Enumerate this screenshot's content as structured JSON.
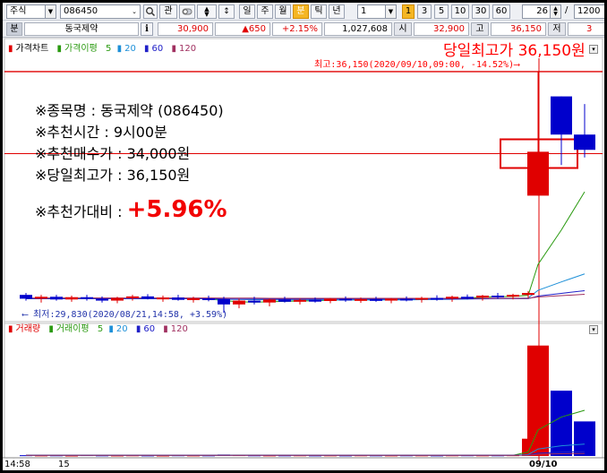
{
  "toolbar": {
    "market": "주식",
    "code": "086450",
    "gwan": "관",
    "periods": [
      "일",
      "주",
      "월",
      "분",
      "틱",
      "년"
    ],
    "period_active": "분",
    "interval_value": "1",
    "minute_buttons": [
      "1",
      "3",
      "5",
      "10",
      "30",
      "60"
    ],
    "minute_active": "1",
    "count_value": "26",
    "slash": "/",
    "total_value": "1200"
  },
  "quote": {
    "bun": "분",
    "name": "동국제약",
    "info_icon": "i",
    "price": "30,900",
    "change": "▲650",
    "change_pct": "+2.15%",
    "volume": "1,027,608",
    "open_label": "시",
    "open": "32,900",
    "high_label": "고",
    "high": "36,150",
    "low_label": "저",
    "low": "3"
  },
  "price_panel": {
    "legend": {
      "chart": "가격차트",
      "ma": "가격이평",
      "ma5": "5",
      "ma20": "20",
      "ma60": "60",
      "ma120": "120"
    },
    "high_annotation_big": "당일최고가 36,150원",
    "high_annotation_small": "최고:36,150(2020/09/10,09:00, -14.52%)⟶",
    "low_annotation": "⟵ 최저:29,830(2020/08/21,14:58, +3.59%)"
  },
  "info_box": {
    "line1": "※종목명 : 동국제약 (086450)",
    "line2": "※추천시간 : 9시00분",
    "line3": "※추천매수가 : 34,000원",
    "line4": "※당일최고가 : 36,150원",
    "line5_label": "※추천가대비 : ",
    "line5_value": "+5.96%"
  },
  "volume_panel": {
    "legend": {
      "vol": "거래량",
      "ma": "거래이평",
      "ma5": "5",
      "ma20": "20",
      "ma60": "60",
      "ma120": "120"
    }
  },
  "xaxis": {
    "labels": [
      "14:58",
      "15",
      "09/10"
    ]
  },
  "colors": {
    "up": "#e00000",
    "down": "#0000cc",
    "ma5": "#2a9a10",
    "ma20": "#1e90d8",
    "ma60": "#2020c8",
    "ma120": "#a03060",
    "accent": "#f5b623"
  },
  "chart_data": [
    {
      "type": "candlestick",
      "title": "가격차트",
      "series": [
        {
          "name": "가격차트",
          "values": [
            {
              "o": 30300,
              "h": 30350,
              "l": 30150,
              "c": 30200
            },
            {
              "o": 30200,
              "h": 30300,
              "l": 30100,
              "c": 30250
            },
            {
              "o": 30250,
              "h": 30300,
              "l": 30150,
              "c": 30180
            },
            {
              "o": 30180,
              "h": 30280,
              "l": 30120,
              "c": 30240
            },
            {
              "o": 30240,
              "h": 30300,
              "l": 30150,
              "c": 30200
            },
            {
              "o": 30200,
              "h": 30260,
              "l": 30100,
              "c": 30150
            },
            {
              "o": 30150,
              "h": 30250,
              "l": 30080,
              "c": 30220
            },
            {
              "o": 30220,
              "h": 30300,
              "l": 30150,
              "c": 30260
            },
            {
              "o": 30260,
              "h": 30320,
              "l": 30180,
              "c": 30200
            },
            {
              "o": 30200,
              "h": 30280,
              "l": 30120,
              "c": 30230
            },
            {
              "o": 30230,
              "h": 30300,
              "l": 30150,
              "c": 30170
            },
            {
              "o": 30170,
              "h": 30250,
              "l": 30100,
              "c": 30210
            },
            {
              "o": 30210,
              "h": 30280,
              "l": 30130,
              "c": 30190
            },
            {
              "o": 30190,
              "h": 30250,
              "l": 29830,
              "c": 30050
            },
            {
              "o": 30050,
              "h": 30200,
              "l": 29950,
              "c": 30150
            },
            {
              "o": 30150,
              "h": 30250,
              "l": 30050,
              "c": 30100
            },
            {
              "o": 30100,
              "h": 30200,
              "l": 30000,
              "c": 30180
            },
            {
              "o": 30180,
              "h": 30250,
              "l": 30100,
              "c": 30120
            },
            {
              "o": 30120,
              "h": 30200,
              "l": 30050,
              "c": 30170
            },
            {
              "o": 30170,
              "h": 30230,
              "l": 30100,
              "c": 30140
            },
            {
              "o": 30140,
              "h": 30220,
              "l": 30080,
              "c": 30200
            },
            {
              "o": 30200,
              "h": 30260,
              "l": 30120,
              "c": 30160
            },
            {
              "o": 30160,
              "h": 30230,
              "l": 30090,
              "c": 30190
            },
            {
              "o": 30190,
              "h": 30250,
              "l": 30120,
              "c": 30150
            },
            {
              "o": 30150,
              "h": 30220,
              "l": 30080,
              "c": 30200
            },
            {
              "o": 30200,
              "h": 30260,
              "l": 30130,
              "c": 30180
            },
            {
              "o": 30180,
              "h": 30250,
              "l": 30100,
              "c": 30220
            },
            {
              "o": 30220,
              "h": 30290,
              "l": 30150,
              "c": 30200
            },
            {
              "o": 30200,
              "h": 30280,
              "l": 30120,
              "c": 30250
            },
            {
              "o": 30250,
              "h": 30310,
              "l": 30180,
              "c": 30230
            },
            {
              "o": 30230,
              "h": 30300,
              "l": 30150,
              "c": 30280
            },
            {
              "o": 30280,
              "h": 30350,
              "l": 30200,
              "c": 30260
            },
            {
              "o": 30260,
              "h": 30330,
              "l": 30180,
              "c": 30300
            },
            {
              "o": 30300,
              "h": 30400,
              "l": 30220,
              "c": 30350
            },
            {
              "o": 32900,
              "h": 36150,
              "l": 32900,
              "c": 34050
            },
            {
              "o": 35500,
              "h": 35500,
              "l": 33700,
              "c": 34500
            },
            {
              "o": 34500,
              "h": 35300,
              "l": 33900,
              "c": 34100
            }
          ]
        },
        {
          "name": "5",
          "values": [
            30200,
            30210,
            30220,
            30215,
            30220,
            30210,
            30200,
            30215,
            30220,
            30210,
            30205,
            30200,
            30195,
            30150,
            30120,
            30110,
            30120,
            30130,
            30140,
            30145,
            30160,
            30170,
            30170,
            30175,
            30180,
            30185,
            30190,
            30200,
            30210,
            30220,
            30240,
            30250,
            30260,
            30290,
            31100,
            32000,
            33000
          ]
        },
        {
          "name": "20",
          "values": [
            30200,
            30200,
            30200,
            30200,
            30200,
            30200,
            30200,
            30200,
            30200,
            30200,
            30200,
            30200,
            30195,
            30185,
            30180,
            30175,
            30170,
            30165,
            30165,
            30165,
            30165,
            30165,
            30165,
            30165,
            30165,
            30170,
            30175,
            30180,
            30185,
            30190,
            30200,
            30205,
            30210,
            30220,
            30420,
            30640,
            30850
          ]
        },
        {
          "name": "60",
          "values": [
            30200,
            30200,
            30200,
            30200,
            30200,
            30200,
            30200,
            30200,
            30200,
            30200,
            30200,
            30200,
            30200,
            30195,
            30190,
            30190,
            30190,
            30190,
            30190,
            30190,
            30190,
            30190,
            30190,
            30190,
            30190,
            30190,
            30190,
            30190,
            30190,
            30195,
            30195,
            30200,
            30200,
            30200,
            30270,
            30340,
            30410
          ]
        },
        {
          "name": "120",
          "values": [
            30220,
            30220,
            30220,
            30220,
            30220,
            30220,
            30220,
            30220,
            30220,
            30220,
            30220,
            30220,
            30220,
            30215,
            30215,
            30215,
            30210,
            30210,
            30210,
            30210,
            30210,
            30210,
            30210,
            30210,
            30210,
            30210,
            30210,
            30210,
            30210,
            30210,
            30210,
            30210,
            30210,
            30210,
            30245,
            30280,
            30315
          ]
        }
      ],
      "ylim": [
        29600,
        36500
      ],
      "reference_lines": [
        36150,
        34000
      ]
    },
    {
      "type": "bar",
      "title": "거래량",
      "series": [
        {
          "name": "거래량",
          "values": [
            800,
            600,
            700,
            500,
            900,
            650,
            550,
            700,
            600,
            500,
            750,
            600,
            650,
            1500,
            900,
            700,
            600,
            650,
            700,
            600,
            650,
            600,
            700,
            650,
            600,
            700,
            650,
            600,
            700,
            750,
            650,
            700,
            800,
            18000,
            115000,
            68000,
            36000
          ]
        },
        {
          "name": "5",
          "values": [
            700,
            700,
            700,
            700,
            700,
            690,
            680,
            660,
            680,
            610,
            630,
            630,
            640,
            800,
            880,
            880,
            870,
            870,
            710,
            650,
            640,
            640,
            660,
            640,
            640,
            650,
            640,
            640,
            650,
            680,
            680,
            680,
            720,
            4180,
            27070,
            40550,
            47600
          ]
        },
        {
          "name": "20",
          "values": [
            650,
            650,
            650,
            650,
            660,
            660,
            660,
            660,
            660,
            660,
            660,
            660,
            660,
            700,
            710,
            710,
            710,
            710,
            710,
            710,
            700,
            700,
            700,
            700,
            690,
            680,
            680,
            670,
            670,
            670,
            660,
            660,
            670,
            1530,
            7250,
            10610,
            12380
          ]
        },
        {
          "name": "60",
          "values": [
            650,
            650,
            650,
            650,
            650,
            650,
            650,
            650,
            650,
            650,
            650,
            650,
            650,
            670,
            670,
            670,
            670,
            670,
            670,
            670,
            670,
            670,
            670,
            670,
            670,
            670,
            670,
            670,
            670,
            670,
            670,
            670,
            670,
            960,
            2870,
            4000,
            4590
          ]
        },
        {
          "name": "120",
          "values": [
            650,
            650,
            650,
            650,
            650,
            650,
            650,
            650,
            650,
            650,
            650,
            650,
            650,
            660,
            660,
            660,
            660,
            660,
            660,
            660,
            660,
            660,
            660,
            660,
            660,
            660,
            660,
            660,
            660,
            660,
            660,
            660,
            660,
            800,
            1760,
            2320,
            2620
          ]
        }
      ],
      "ylim": [
        0,
        125000
      ]
    }
  ]
}
